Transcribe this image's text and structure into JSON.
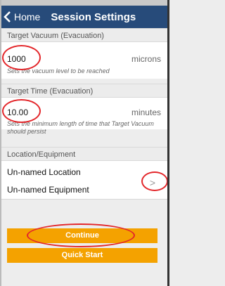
{
  "nav": {
    "back_label": "Home",
    "title": "Session Settings"
  },
  "vacuum": {
    "header": "Target Vacuum (Evacuation)",
    "value": "1000",
    "unit": "microns",
    "hint": "Sets the vacuum level to be reached"
  },
  "time": {
    "header": "Target Time (Evacuation)",
    "value": "10.00",
    "unit": "minutes",
    "hint": "Sets the minimum length of time that Target Vacuum should persist"
  },
  "location": {
    "header": "Location/Equipment",
    "location_label": "Un-named Location",
    "equipment_label": "Un-named Equipment"
  },
  "buttons": {
    "continue_label": "Continue",
    "quick_start_label": "Quick Start"
  },
  "colors": {
    "nav_bar": "#274b7a",
    "button": "#f4a200",
    "annotation": "#e3262a"
  }
}
